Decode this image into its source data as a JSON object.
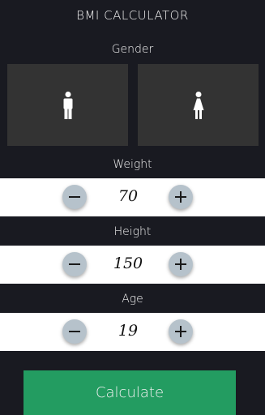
{
  "app": {
    "title": "BMI CALCULATOR"
  },
  "gender": {
    "label": "Gender",
    "options": [
      {
        "id": "male",
        "icon": "male-icon"
      },
      {
        "id": "female",
        "icon": "female-icon"
      }
    ]
  },
  "weight": {
    "label": "Weight",
    "value": "70"
  },
  "height": {
    "label": "Height",
    "value": "150"
  },
  "age": {
    "label": "Age",
    "value": "19"
  },
  "actions": {
    "calculate_label": "Calculate"
  },
  "colors": {
    "background": "#191a21",
    "card": "#333333",
    "stepper_button": "#b6c2cb",
    "calculate": "#239c61"
  }
}
